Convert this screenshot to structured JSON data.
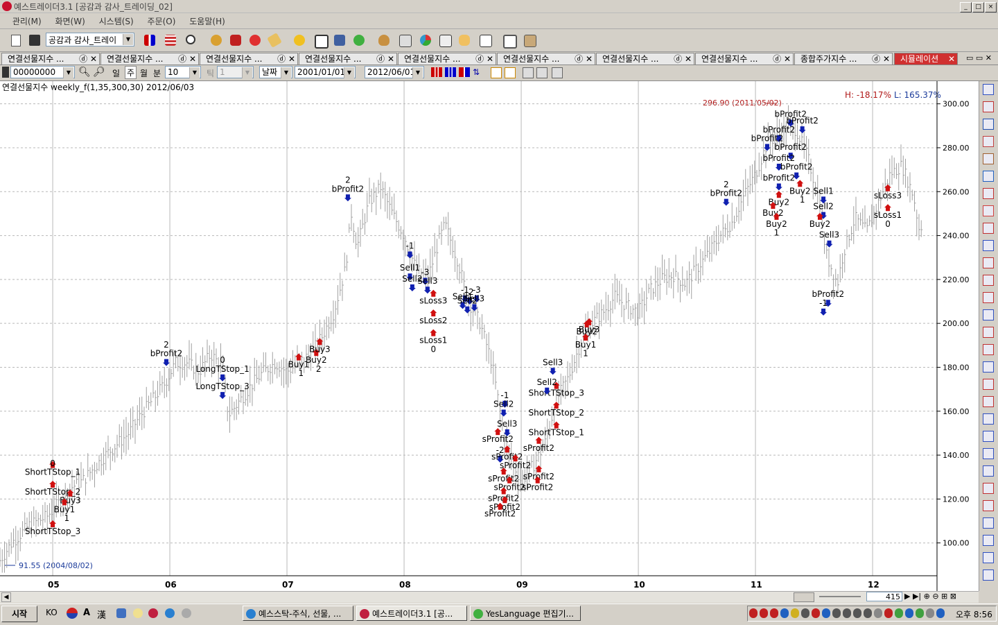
{
  "window": {
    "title": "예스트레이더3.1  [공감과 감사_트레이딩_02]",
    "controls": [
      "_",
      "□",
      "×"
    ]
  },
  "menu": [
    "관리(M)",
    "화면(W)",
    "시스템(S)",
    "주문(O)",
    "도움말(H)"
  ],
  "toolbar": {
    "workspace_select": "공감과 감사_트레이",
    "icons": [
      "new-page-icon",
      "save-icon",
      "candle-chart-icon",
      "table-icon",
      "magnifier-icon",
      "order-icon",
      "stop-icon",
      "alert-icon",
      "ticket-icon",
      "si-icon",
      "tv-icon",
      "ss-icon",
      "yl-icon",
      "moneybag-icon",
      "calculator-icon",
      "pie-icon",
      "screen-icon",
      "hand-icon",
      "news-icon",
      "expand-icon",
      "square-icon"
    ]
  },
  "tabs": [
    {
      "label": "연결선물지수 ..."
    },
    {
      "label": "연결선물지수 ..."
    },
    {
      "label": "연결선물지수 ..."
    },
    {
      "label": "연결선물지수 ..."
    },
    {
      "label": "연결선물지수 ..."
    },
    {
      "label": "연결선물지수 ..."
    },
    {
      "label": "연결선물지수 ..."
    },
    {
      "label": "연결선물지수 ..."
    },
    {
      "label": "종합주가지수 ..."
    },
    {
      "label": "시뮬레이션",
      "active": true
    }
  ],
  "chart_toolbar": {
    "code": "00000000",
    "periods": [
      "일",
      "주",
      "월",
      "분"
    ],
    "selected_period": "주",
    "count": "10",
    "tick_label": "틱",
    "tick_value": "1",
    "axis_type": "날짜",
    "start_date": "2001/01/01",
    "end_date": "2012/06/01"
  },
  "chart_header": {
    "title": "연결선물지수 weekly_f(1,35,300,30)  2012/06/03",
    "high_pct": "H: -18.17%",
    "low_pct": "L: 165.37%",
    "max_note": "296.90 (2011/05/02)",
    "min_note": "91.55 (2004/08/02)"
  },
  "chart_data": {
    "type": "bar",
    "x_ticks": [
      "05",
      "06",
      "07",
      "08",
      "09",
      "10",
      "11",
      "12"
    ],
    "y_ticks": [
      "300.00",
      "280.00",
      "260.00",
      "240.00",
      "220.00",
      "200.00",
      "180.00",
      "160.00",
      "140.00",
      "120.00",
      "100.00"
    ],
    "ylim": [
      86,
      304
    ],
    "xlim": [
      2004.55,
      2012.55
    ],
    "grid": true,
    "series_close_path": [
      [
        2004.55,
        92
      ],
      [
        2004.65,
        100
      ],
      [
        2004.8,
        108
      ],
      [
        2004.95,
        112
      ],
      [
        2005.05,
        118
      ],
      [
        2005.15,
        125
      ],
      [
        2005.25,
        128
      ],
      [
        2005.35,
        134
      ],
      [
        2005.45,
        140
      ],
      [
        2005.55,
        145
      ],
      [
        2005.65,
        150
      ],
      [
        2005.75,
        158
      ],
      [
        2005.85,
        165
      ],
      [
        2005.95,
        172
      ],
      [
        2006.05,
        182
      ],
      [
        2006.15,
        182
      ],
      [
        2006.25,
        178
      ],
      [
        2006.35,
        186
      ],
      [
        2006.45,
        180
      ],
      [
        2006.5,
        158
      ],
      [
        2006.6,
        165
      ],
      [
        2006.7,
        172
      ],
      [
        2006.8,
        178
      ],
      [
        2006.9,
        182
      ],
      [
        2007.0,
        178
      ],
      [
        2007.1,
        182
      ],
      [
        2007.2,
        186
      ],
      [
        2007.3,
        194
      ],
      [
        2007.4,
        205
      ],
      [
        2007.5,
        225
      ],
      [
        2007.55,
        250
      ],
      [
        2007.6,
        235
      ],
      [
        2007.7,
        255
      ],
      [
        2007.8,
        262
      ],
      [
        2007.9,
        250
      ],
      [
        2008.0,
        240
      ],
      [
        2008.1,
        225
      ],
      [
        2008.2,
        220
      ],
      [
        2008.3,
        238
      ],
      [
        2008.35,
        245
      ],
      [
        2008.45,
        230
      ],
      [
        2008.55,
        210
      ],
      [
        2008.65,
        200
      ],
      [
        2008.75,
        182
      ],
      [
        2008.85,
        150
      ],
      [
        2008.9,
        140
      ],
      [
        2009.0,
        128
      ],
      [
        2009.1,
        135
      ],
      [
        2009.2,
        145
      ],
      [
        2009.3,
        165
      ],
      [
        2009.4,
        175
      ],
      [
        2009.5,
        190
      ],
      [
        2009.6,
        200
      ],
      [
        2009.7,
        205
      ],
      [
        2009.8,
        212
      ],
      [
        2009.9,
        208
      ],
      [
        2010.0,
        205
      ],
      [
        2010.1,
        215
      ],
      [
        2010.2,
        220
      ],
      [
        2010.3,
        222
      ],
      [
        2010.4,
        218
      ],
      [
        2010.5,
        225
      ],
      [
        2010.6,
        232
      ],
      [
        2010.7,
        240
      ],
      [
        2010.8,
        246
      ],
      [
        2010.9,
        258
      ],
      [
        2011.0,
        268
      ],
      [
        2011.1,
        282
      ],
      [
        2011.2,
        286
      ],
      [
        2011.3,
        290
      ],
      [
        2011.35,
        288
      ],
      [
        2011.45,
        275
      ],
      [
        2011.55,
        255
      ],
      [
        2011.6,
        232
      ],
      [
        2011.7,
        218
      ],
      [
        2011.75,
        232
      ],
      [
        2011.85,
        248
      ],
      [
        2011.95,
        242
      ],
      [
        2012.05,
        255
      ],
      [
        2012.15,
        268
      ],
      [
        2012.25,
        272
      ],
      [
        2012.35,
        258
      ],
      [
        2012.4,
        242
      ],
      [
        2012.42,
        245
      ]
    ],
    "signal_labels": [
      {
        "text": "ShortTStop_1",
        "x": 2005.0,
        "y": 131,
        "color": "#000"
      },
      {
        "text": "ShortTStop_2",
        "x": 2005.0,
        "y": 122,
        "color": "#000"
      },
      {
        "text": "ShortTStop_3",
        "x": 2005.0,
        "y": 104,
        "color": "#000"
      },
      {
        "text": "0",
        "x": 2005.0,
        "y": 135,
        "color": "#000"
      },
      {
        "text": "Buy3",
        "x": 2005.15,
        "y": 118,
        "color": "#000"
      },
      {
        "text": "Buy1",
        "x": 2005.1,
        "y": 114,
        "color": "#000"
      },
      {
        "text": "1",
        "x": 2005.12,
        "y": 110,
        "color": "#000"
      },
      {
        "text": "2",
        "x": 2005.97,
        "y": 189,
        "color": "#000"
      },
      {
        "text": "bProfit2",
        "x": 2005.97,
        "y": 185,
        "color": "#000"
      },
      {
        "text": "0",
        "x": 2006.45,
        "y": 182,
        "color": "#000"
      },
      {
        "text": "LongTStop_1",
        "x": 2006.45,
        "y": 178,
        "color": "#000"
      },
      {
        "text": "LongTStop_3",
        "x": 2006.45,
        "y": 170,
        "color": "#000"
      },
      {
        "text": "Buy1",
        "x": 2007.1,
        "y": 180,
        "color": "#000"
      },
      {
        "text": "1",
        "x": 2007.12,
        "y": 176,
        "color": "#000"
      },
      {
        "text": "Buy2",
        "x": 2007.25,
        "y": 182,
        "color": "#000"
      },
      {
        "text": "Buy3",
        "x": 2007.28,
        "y": 187,
        "color": "#000"
      },
      {
        "text": "2",
        "x": 2007.27,
        "y": 178,
        "color": "#000"
      },
      {
        "text": "2",
        "x": 2007.52,
        "y": 264,
        "color": "#000"
      },
      {
        "text": "bProfit2",
        "x": 2007.52,
        "y": 260,
        "color": "#000"
      },
      {
        "text": "-1",
        "x": 2008.05,
        "y": 234,
        "color": "#000"
      },
      {
        "text": "Sell1",
        "x": 2008.05,
        "y": 224,
        "color": "#000"
      },
      {
        "text": "Sell2",
        "x": 2008.07,
        "y": 219,
        "color": "#000"
      },
      {
        "text": "-3",
        "x": 2008.18,
        "y": 222,
        "color": "#000"
      },
      {
        "text": "Sell3",
        "x": 2008.2,
        "y": 218,
        "color": "#000"
      },
      {
        "text": "sLoss3",
        "x": 2008.25,
        "y": 209,
        "color": "#000"
      },
      {
        "text": "sLoss2",
        "x": 2008.25,
        "y": 200,
        "color": "#000"
      },
      {
        "text": "sLoss1",
        "x": 2008.25,
        "y": 191,
        "color": "#000"
      },
      {
        "text": "0",
        "x": 2008.25,
        "y": 187,
        "color": "#000"
      },
      {
        "text": "-1",
        "x": 2008.52,
        "y": 214,
        "color": "#000"
      },
      {
        "text": "-2",
        "x": 2008.56,
        "y": 213,
        "color": "#000"
      },
      {
        "text": "-3",
        "x": 2008.62,
        "y": 214,
        "color": "#000"
      },
      {
        "text": "Sell1",
        "x": 2008.5,
        "y": 211,
        "color": "#000"
      },
      {
        "text": "Sell2",
        "x": 2008.54,
        "y": 209,
        "color": "#000"
      },
      {
        "text": "Sell3",
        "x": 2008.6,
        "y": 210,
        "color": "#000"
      },
      {
        "text": "-1",
        "x": 2008.86,
        "y": 166,
        "color": "#000"
      },
      {
        "text": "Sell2",
        "x": 2008.85,
        "y": 162,
        "color": "#000"
      },
      {
        "text": "Sell3",
        "x": 2008.88,
        "y": 153,
        "color": "#000"
      },
      {
        "text": "sProfit2",
        "x": 2008.8,
        "y": 146,
        "color": "#000"
      },
      {
        "text": "-2",
        "x": 2008.82,
        "y": 141,
        "color": "#000"
      },
      {
        "text": "sProfit2",
        "x": 2008.88,
        "y": 138,
        "color": "#000"
      },
      {
        "text": "sProfit2",
        "x": 2008.95,
        "y": 134,
        "color": "#000"
      },
      {
        "text": "sProfit2",
        "x": 2008.85,
        "y": 128,
        "color": "#000"
      },
      {
        "text": "sProfit2",
        "x": 2008.9,
        "y": 124,
        "color": "#000"
      },
      {
        "text": "sProfit2",
        "x": 2008.85,
        "y": 119,
        "color": "#000"
      },
      {
        "text": "sProfit2",
        "x": 2008.86,
        "y": 115,
        "color": "#000"
      },
      {
        "text": "sProfit2",
        "x": 2008.82,
        "y": 112,
        "color": "#000"
      },
      {
        "text": "sProfit2",
        "x": 2009.15,
        "y": 142,
        "color": "#000"
      },
      {
        "text": "sProfit2",
        "x": 2009.15,
        "y": 129,
        "color": "#000"
      },
      {
        "text": "sProfit2",
        "x": 2009.14,
        "y": 124,
        "color": "#000"
      },
      {
        "text": "ShortTStop_3",
        "x": 2009.3,
        "y": 167,
        "color": "#000"
      },
      {
        "text": "ShortTStop_2",
        "x": 2009.3,
        "y": 158,
        "color": "#000"
      },
      {
        "text": "ShortTStop_1",
        "x": 2009.3,
        "y": 149,
        "color": "#000"
      },
      {
        "text": "Sell2",
        "x": 2009.22,
        "y": 172,
        "color": "#000"
      },
      {
        "text": "Sell3",
        "x": 2009.27,
        "y": 181,
        "color": "#000"
      },
      {
        "text": "Buy3",
        "x": 2009.58,
        "y": 196,
        "color": "#000"
      },
      {
        "text": "Buy2",
        "x": 2009.56,
        "y": 195,
        "color": "#000"
      },
      {
        "text": "Buy1",
        "x": 2009.55,
        "y": 189,
        "color": "#000"
      },
      {
        "text": "1",
        "x": 2009.55,
        "y": 185,
        "color": "#000"
      },
      {
        "text": "2",
        "x": 2010.75,
        "y": 262,
        "color": "#000"
      },
      {
        "text": "bProfit2",
        "x": 2010.75,
        "y": 258,
        "color": "#000"
      },
      {
        "text": "bProfit2",
        "x": 2011.3,
        "y": 294,
        "color": "#000"
      },
      {
        "text": "bProfit2",
        "x": 2011.4,
        "y": 291,
        "color": "#000"
      },
      {
        "text": "bProfit2",
        "x": 2011.2,
        "y": 287,
        "color": "#000"
      },
      {
        "text": "bProfit2",
        "x": 2011.1,
        "y": 283,
        "color": "#000"
      },
      {
        "text": "bProfit2",
        "x": 2011.3,
        "y": 279,
        "color": "#000"
      },
      {
        "text": "bProfit2",
        "x": 2011.2,
        "y": 274,
        "color": "#000"
      },
      {
        "text": "bProfit2",
        "x": 2011.35,
        "y": 270,
        "color": "#000"
      },
      {
        "text": "bProfit2",
        "x": 2011.2,
        "y": 265,
        "color": "#000"
      },
      {
        "text": "Buy2",
        "x": 2011.2,
        "y": 254,
        "color": "#000"
      },
      {
        "text": "Buy2",
        "x": 2011.15,
        "y": 249,
        "color": "#000"
      },
      {
        "text": "Buy2",
        "x": 2011.18,
        "y": 244,
        "color": "#000"
      },
      {
        "text": "1",
        "x": 2011.18,
        "y": 240,
        "color": "#000"
      },
      {
        "text": "Buy2",
        "x": 2011.38,
        "y": 259,
        "color": "#000"
      },
      {
        "text": "1",
        "x": 2011.4,
        "y": 255,
        "color": "#000"
      },
      {
        "text": "Sell1",
        "x": 2011.58,
        "y": 259,
        "color": "#000"
      },
      {
        "text": "Sell2",
        "x": 2011.58,
        "y": 252,
        "color": "#000"
      },
      {
        "text": "Buy2",
        "x": 2011.55,
        "y": 244,
        "color": "#000"
      },
      {
        "text": "Sell3",
        "x": 2011.63,
        "y": 239,
        "color": "#000"
      },
      {
        "text": "bProfit2",
        "x": 2011.62,
        "y": 212,
        "color": "#000"
      },
      {
        "text": "-1",
        "x": 2011.58,
        "y": 208,
        "color": "#000"
      },
      {
        "text": "sLoss3",
        "x": 2012.13,
        "y": 257,
        "color": "#000"
      },
      {
        "text": "sLoss1",
        "x": 2012.13,
        "y": 248,
        "color": "#000"
      },
      {
        "text": "0",
        "x": 2012.13,
        "y": 244,
        "color": "#000"
      }
    ]
  },
  "statusbar": {
    "page_count": "415"
  },
  "taskbar": {
    "start_label": "시작",
    "ime_labels": [
      "KO",
      "A",
      "漢"
    ],
    "tasks": [
      {
        "label": "예스스탁-주식, 선물, ..."
      },
      {
        "label": "예스트레이더3.1 [공..."
      },
      {
        "label": "YesLanguage 편집기..."
      }
    ],
    "clock": "오후 8:56"
  },
  "colors": {
    "up_arrow": "#d01010",
    "down_arrow": "#1020b0",
    "price_bar": "#a0a0a0",
    "grid": "#b8b8b8",
    "note_red": "#b01818",
    "note_blue": "#1a3a9a"
  }
}
